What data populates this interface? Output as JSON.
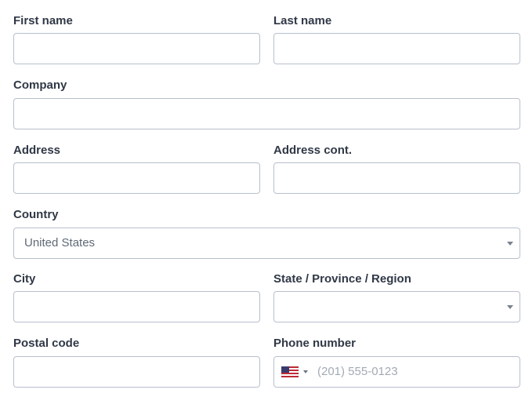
{
  "form": {
    "first_name": {
      "label": "First name",
      "value": "",
      "placeholder": ""
    },
    "last_name": {
      "label": "Last name",
      "value": "",
      "placeholder": ""
    },
    "company": {
      "label": "Company",
      "value": "",
      "placeholder": ""
    },
    "address": {
      "label": "Address",
      "value": "",
      "placeholder": ""
    },
    "address_cont": {
      "label": "Address cont.",
      "value": "",
      "placeholder": ""
    },
    "country": {
      "label": "Country",
      "selected": "United States",
      "icon": "chevron-down-icon"
    },
    "city": {
      "label": "City",
      "value": "",
      "placeholder": ""
    },
    "state": {
      "label": "State / Province / Region",
      "selected": "",
      "icon": "chevron-down-icon"
    },
    "postal_code": {
      "label": "Postal code",
      "value": "",
      "placeholder": ""
    },
    "phone": {
      "label": "Phone number",
      "value": "",
      "placeholder": "(201) 555-0123",
      "country_flag": "us-flag-icon",
      "country_dropdown_icon": "chevron-down-icon"
    }
  },
  "colors": {
    "label": "#303846",
    "border": "#b8c0cc",
    "select_text": "#5f6977",
    "placeholder": "#a3aab5",
    "flag_red": "#bf2c37",
    "flag_blue": "#3c3b6e"
  }
}
